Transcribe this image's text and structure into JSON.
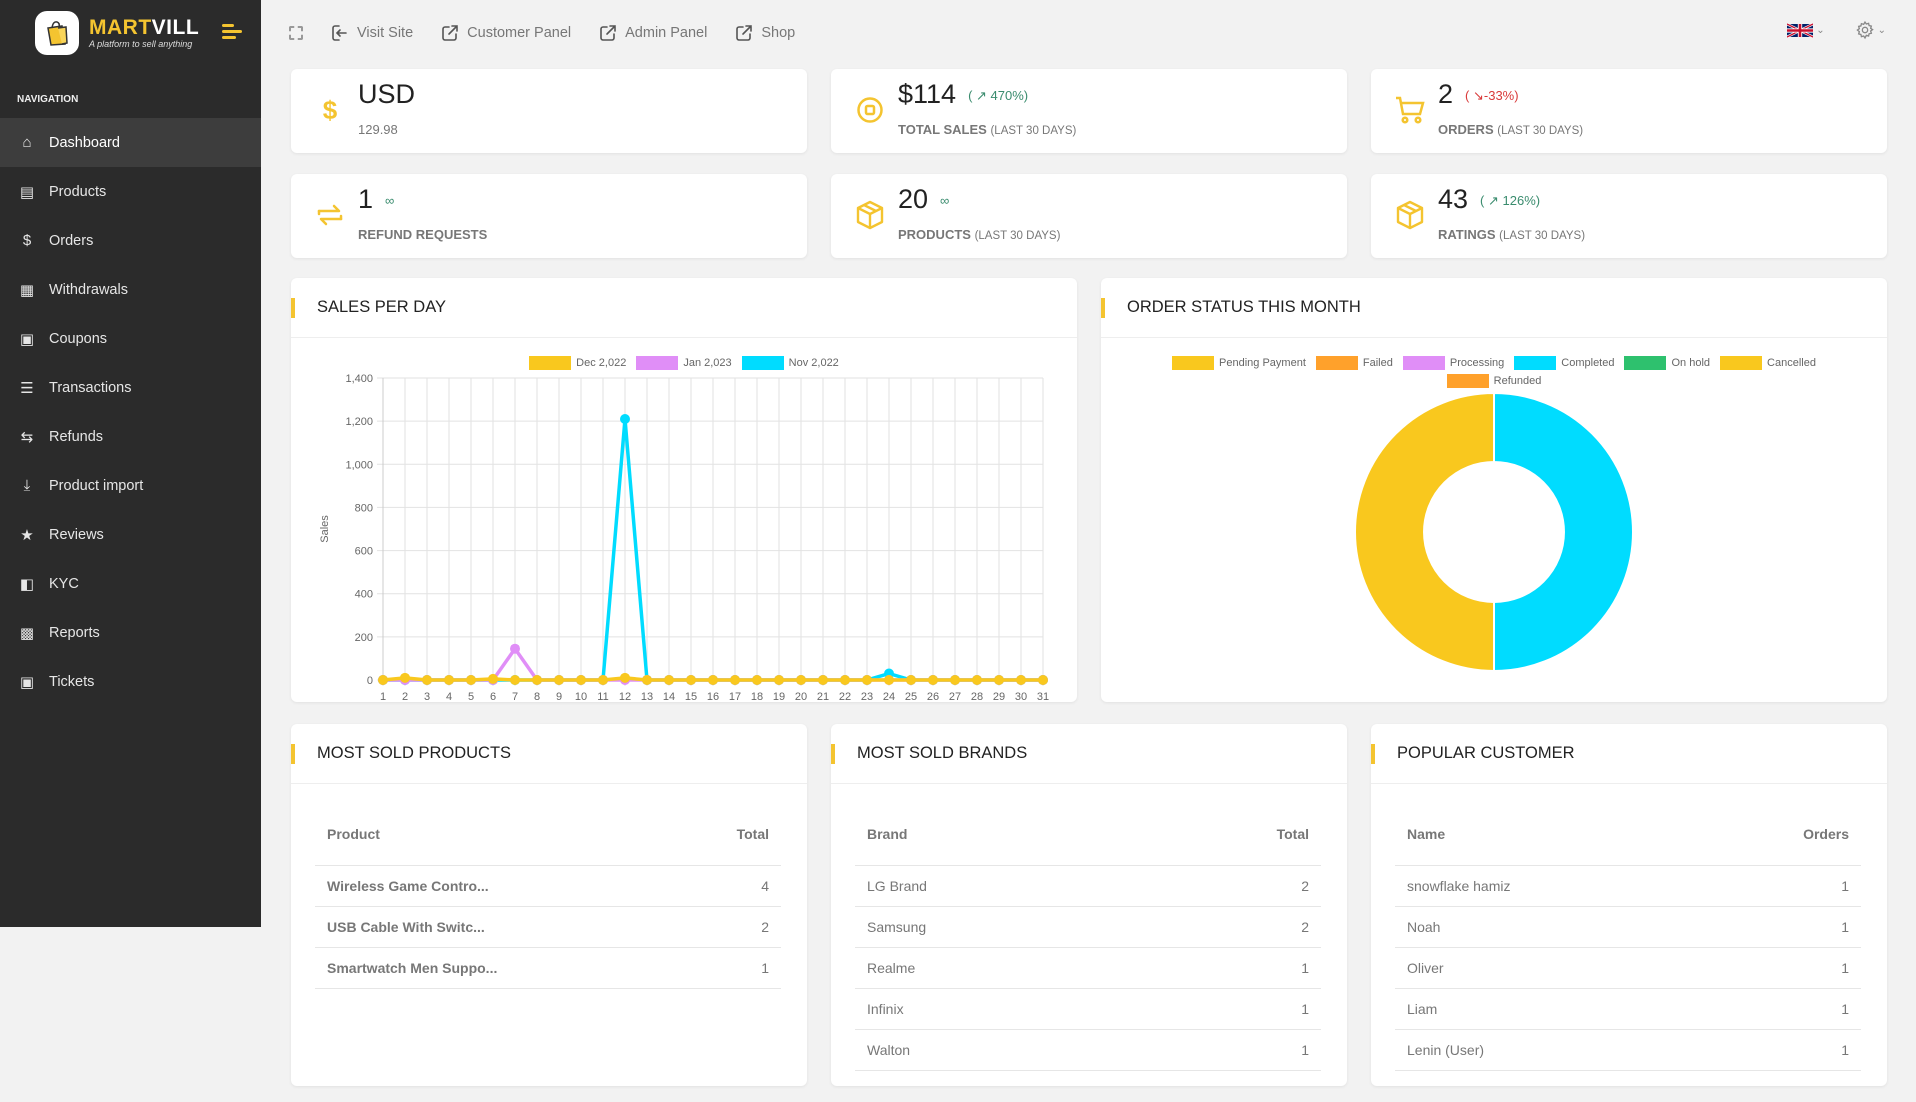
{
  "brand": {
    "name_part1": "MART",
    "name_part2": "VILL",
    "tagline": "A platform to sell anything"
  },
  "sidebar": {
    "header": "NAVIGATION",
    "items": [
      {
        "label": "Dashboard",
        "icon": "home-icon",
        "active": true
      },
      {
        "label": "Products",
        "icon": "database-icon"
      },
      {
        "label": "Orders",
        "icon": "dollar-icon"
      },
      {
        "label": "Withdrawals",
        "icon": "credit-card-icon"
      },
      {
        "label": "Coupons",
        "icon": "ticket-icon"
      },
      {
        "label": "Transactions",
        "icon": "list-icon"
      },
      {
        "label": "Refunds",
        "icon": "retweet-icon"
      },
      {
        "label": "Product import",
        "icon": "download-icon"
      },
      {
        "label": "Reviews",
        "icon": "star-icon"
      },
      {
        "label": "KYC",
        "icon": "id-card-icon"
      },
      {
        "label": "Reports",
        "icon": "bar-chart-icon"
      },
      {
        "label": "Tickets",
        "icon": "ticket-icon"
      }
    ]
  },
  "topbar": {
    "links": [
      {
        "label": "Visit Site",
        "icon": "sign-in-icon"
      },
      {
        "label": "Customer Panel",
        "icon": "external-link-icon"
      },
      {
        "label": "Admin Panel",
        "icon": "external-link-icon"
      },
      {
        "label": "Shop",
        "icon": "external-link-icon"
      }
    ],
    "language": "English (UK flag)",
    "settings_icon": "gear-icon"
  },
  "stats": {
    "currency": {
      "value": "USD",
      "sub": "129.98"
    },
    "total_sales": {
      "value": "$114",
      "change": "470%",
      "trend": "up",
      "label": "TOTAL SALES",
      "period": "(LAST 30 DAYS)"
    },
    "orders": {
      "value": "2",
      "change": "-33%",
      "trend": "down",
      "label": "ORDERS",
      "period": "(LAST 30 DAYS)"
    },
    "refunds": {
      "value": "1",
      "change": "∞",
      "label": "REFUND REQUESTS"
    },
    "products": {
      "value": "20",
      "change": "∞",
      "label": "PRODUCTS",
      "period": "(LAST 30 DAYS)"
    },
    "ratings": {
      "value": "43",
      "change": "126%",
      "trend": "up",
      "label": "RATINGS",
      "period": "(LAST 30 DAYS)"
    }
  },
  "sales_panel": {
    "title": "SALES PER DAY"
  },
  "order_status_panel": {
    "title": "ORDER STATUS THIS MONTH"
  },
  "chart_data": [
    {
      "type": "line",
      "title": "SALES PER DAY",
      "xlabel": "",
      "ylabel": "Sales",
      "ylim": [
        0,
        1400
      ],
      "yticks": [
        0,
        200,
        400,
        600,
        800,
        1000,
        1200,
        1400
      ],
      "yticklabels": [
        "0",
        "200",
        "400",
        "600",
        "800",
        "1,000",
        "1,200",
        "1,400"
      ],
      "x": [
        1,
        2,
        3,
        4,
        5,
        6,
        7,
        8,
        9,
        10,
        11,
        12,
        13,
        14,
        15,
        16,
        17,
        18,
        19,
        20,
        21,
        22,
        23,
        24,
        25,
        26,
        27,
        28,
        29,
        30,
        31
      ],
      "grid": true,
      "legend_position": "top",
      "series": [
        {
          "name": "Dec 2,022",
          "color": "#f9c81e",
          "values": [
            0,
            10,
            0,
            0,
            0,
            5,
            0,
            0,
            0,
            0,
            0,
            10,
            0,
            0,
            0,
            0,
            0,
            0,
            0,
            0,
            0,
            0,
            0,
            0,
            0,
            0,
            0,
            0,
            0,
            0,
            0
          ]
        },
        {
          "name": "Jan 2,023",
          "color": "#e08ef7",
          "values": [
            0,
            0,
            0,
            0,
            0,
            0,
            145,
            0,
            0,
            0,
            0,
            0,
            0,
            0,
            0,
            0,
            0,
            0,
            0,
            0,
            0,
            0,
            0,
            0,
            0,
            0,
            0,
            0,
            0,
            0,
            0
          ]
        },
        {
          "name": "Nov 2,022",
          "color": "#00dcff",
          "values": [
            0,
            0,
            0,
            0,
            0,
            0,
            0,
            0,
            0,
            0,
            0,
            1210,
            0,
            0,
            0,
            0,
            0,
            0,
            0,
            0,
            0,
            0,
            0,
            30,
            0,
            0,
            0,
            0,
            0,
            0,
            0
          ]
        }
      ]
    },
    {
      "type": "pie",
      "variant": "doughnut",
      "title": "ORDER STATUS THIS MONTH",
      "legend_position": "top",
      "legend": [
        {
          "name": "Pending Payment",
          "color": "#f9c81e"
        },
        {
          "name": "Failed",
          "color": "#ffa12b"
        },
        {
          "name": "Processing",
          "color": "#e08ef7"
        },
        {
          "name": "Completed",
          "color": "#00dcff"
        },
        {
          "name": "On hold",
          "color": "#2ec16e"
        },
        {
          "name": "Cancelled",
          "color": "#f9c81e"
        },
        {
          "name": "Refunded",
          "color": "#ffa12b"
        }
      ],
      "slices": [
        {
          "name": "Completed",
          "value": 50,
          "color": "#00dcff"
        },
        {
          "name": "Pending Payment or Cancelled (indistinguishable; both legend entries share this color)",
          "value": 50,
          "color": "#f9c81e"
        }
      ]
    }
  ],
  "most_sold_products": {
    "title": "MOST SOLD PRODUCTS",
    "columns": [
      "Product",
      "Total"
    ],
    "rows": [
      [
        "Wireless Game Contro...",
        "4"
      ],
      [
        "USB Cable With Switc...",
        "2"
      ],
      [
        "Smartwatch Men Suppo...",
        "1"
      ]
    ]
  },
  "most_sold_brands": {
    "title": "MOST SOLD BRANDS",
    "columns": [
      "Brand",
      "Total"
    ],
    "rows": [
      [
        "LG Brand",
        "2"
      ],
      [
        "Samsung",
        "2"
      ],
      [
        "Realme",
        "1"
      ],
      [
        "Infinix",
        "1"
      ],
      [
        "Walton",
        "1"
      ]
    ]
  },
  "popular_customer": {
    "title": "POPULAR CUSTOMER",
    "columns": [
      "Name",
      "Orders"
    ],
    "rows": [
      [
        "snowflake hamiz",
        "1"
      ],
      [
        "Noah",
        "1"
      ],
      [
        "Oliver",
        "1"
      ],
      [
        "Liam",
        "1"
      ],
      [
        "Lenin (User)",
        "1"
      ]
    ]
  }
}
